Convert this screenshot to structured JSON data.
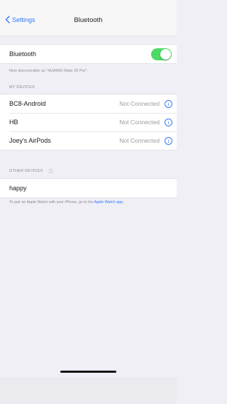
{
  "nav": {
    "back_label": "Settings",
    "title": "Bluetooth"
  },
  "bluetooth": {
    "label": "Bluetooth",
    "enabled": true,
    "discoverable_note": "Now discoverable as \"HUAWEI Mate 30 Pro\"."
  },
  "my_devices": {
    "header": "MY DEVICES",
    "devices": [
      {
        "name": "BC8-Android",
        "status": "Not Connected",
        "info_icon": "ⓘ"
      },
      {
        "name": "HB",
        "status": "Not Connected",
        "info_icon": "ⓘ"
      },
      {
        "name": "Joey's AirPods",
        "status": "Not Connected",
        "info_icon": "ⓘ"
      }
    ]
  },
  "other_devices": {
    "header": "OTHER DEVICES",
    "devices": [
      {
        "name": "happy"
      }
    ]
  },
  "footer": {
    "text": "To pair an Apple Watch with your iPhone, go to the ",
    "link": "Apple Watch app."
  },
  "colors": {
    "accent": "#3478f6",
    "toggle_on": "#4cd964",
    "background": "#f0eff5"
  }
}
